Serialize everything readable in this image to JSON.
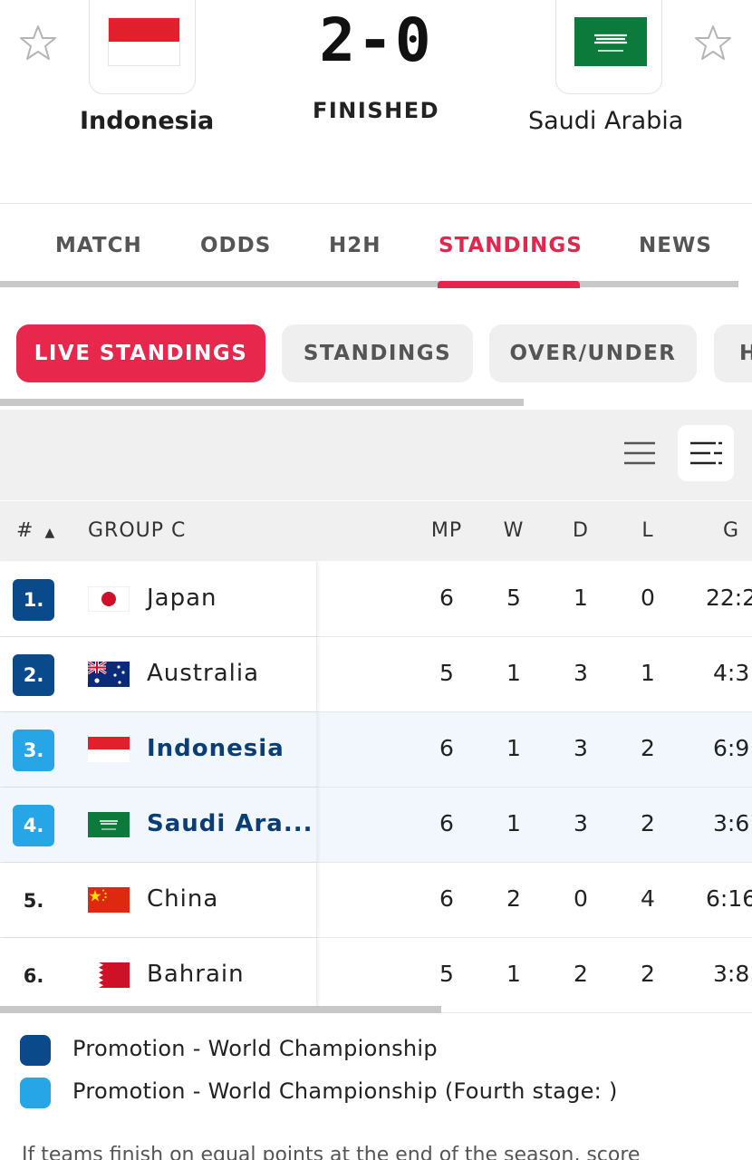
{
  "match": {
    "home_team": "Indonesia",
    "away_team": "Saudi Arabia",
    "score": "2-0",
    "status": "FINISHED"
  },
  "tabs": [
    {
      "label": "MATCH",
      "active": false
    },
    {
      "label": "ODDS",
      "active": false
    },
    {
      "label": "H2H",
      "active": false
    },
    {
      "label": "STANDINGS",
      "active": true
    },
    {
      "label": "NEWS",
      "active": false
    }
  ],
  "subtabs": [
    {
      "label": "LIVE STANDINGS",
      "active": true
    },
    {
      "label": "STANDINGS",
      "active": false
    },
    {
      "label": "OVER/UNDER",
      "active": false
    },
    {
      "label": "H",
      "active": false
    }
  ],
  "view_toggle": {
    "options": [
      "short-view-icon",
      "full-view-icon"
    ],
    "selected": "full-view-icon"
  },
  "table": {
    "headers": {
      "rank": "#",
      "group": "GROUP C",
      "mp": "MP",
      "w": "W",
      "d": "D",
      "l": "L",
      "g": "G"
    },
    "rows": [
      {
        "rank": "1.",
        "team": "Japan",
        "mp": "6",
        "w": "5",
        "d": "1",
        "l": "0",
        "g": "22:2",
        "zone": "promotion",
        "highlight": false
      },
      {
        "rank": "2.",
        "team": "Australia",
        "mp": "5",
        "w": "1",
        "d": "3",
        "l": "1",
        "g": "4:3",
        "zone": "promotion",
        "highlight": false
      },
      {
        "rank": "3.",
        "team": "Indonesia",
        "mp": "6",
        "w": "1",
        "d": "3",
        "l": "2",
        "g": "6:9",
        "zone": "fourth-stage",
        "highlight": true
      },
      {
        "rank": "4.",
        "team": "Saudi Ara...",
        "mp": "6",
        "w": "1",
        "d": "3",
        "l": "2",
        "g": "3:6",
        "zone": "fourth-stage",
        "highlight": true
      },
      {
        "rank": "5.",
        "team": "China",
        "mp": "6",
        "w": "2",
        "d": "0",
        "l": "4",
        "g": "6:16",
        "zone": "none",
        "highlight": false
      },
      {
        "rank": "6.",
        "team": "Bahrain",
        "mp": "5",
        "w": "1",
        "d": "2",
        "l": "2",
        "g": "3:8",
        "zone": "none",
        "highlight": false
      }
    ]
  },
  "legend": [
    {
      "label": "Promotion - World Championship",
      "color": "#0a4a8a"
    },
    {
      "label": "Promotion - World Championship (Fourth stage: )",
      "color": "#26a6e6"
    }
  ],
  "note": "If teams finish on equal points at the end of the season, score",
  "colors": {
    "accent": "#e2264d",
    "promotion": "#0a4a8a",
    "fourth_stage": "#26a6e6"
  }
}
